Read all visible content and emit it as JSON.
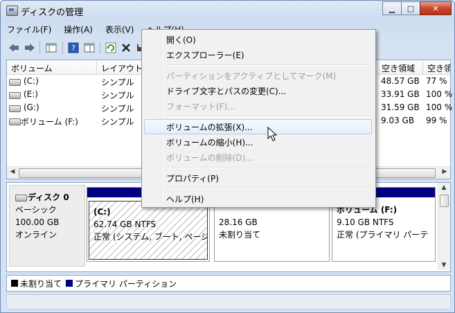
{
  "window": {
    "title": "ディスクの管理"
  },
  "caption_buttons": {
    "minimize": "▁",
    "maximize": "□",
    "close": "✕"
  },
  "menubar": [
    "ファイル(F)",
    "操作(A)",
    "表示(V)",
    "ヘルプ(H)"
  ],
  "volume_list": {
    "columns": [
      "ボリューム",
      "レイアウト",
      "空き領域",
      "空き領"
    ],
    "rows": [
      {
        "volume": "(C:)",
        "layout": "シンプル",
        "free": "48.57 GB",
        "pct": "77 %"
      },
      {
        "volume": "(E:)",
        "layout": "シンプル",
        "free": "33.91 GB",
        "pct": "100 %"
      },
      {
        "volume": "(G:)",
        "layout": "シンプル",
        "free": "31.59 GB",
        "pct": "100 %"
      },
      {
        "volume": "ボリューム (F:)",
        "layout": "シンプル",
        "free": "9.03 GB",
        "pct": "99 %"
      }
    ]
  },
  "disk": {
    "name": "ディスク 0",
    "type": "ベーシック",
    "size": "100.00 GB",
    "status": "オンライン",
    "partitions": [
      {
        "title": "(C:)",
        "size": "62.74 GB NTFS",
        "status": "正常 (システム, ブート, ページ"
      },
      {
        "title": "",
        "size": "28.16 GB",
        "status": "未割り当て"
      },
      {
        "title": "ボリューム (F:)",
        "size": "9.10 GB NTFS",
        "status": "正常 (プライマリ パーテ"
      }
    ]
  },
  "legend": {
    "unallocated": "未割り当て",
    "primary": "プライマリ パーティション",
    "unallocated_color": "#000000",
    "primary_color": "#000080"
  },
  "context_menu": {
    "items": [
      {
        "label": "開く(O)",
        "disabled": false
      },
      {
        "label": "エクスプローラー(E)",
        "disabled": false
      },
      {
        "label": "パーティションをアクティブとしてマーク(M)",
        "disabled": true
      },
      {
        "label": "ドライブ文字とパスの変更(C)...",
        "disabled": false
      },
      {
        "label": "フォーマット(F)...",
        "disabled": true
      },
      {
        "label": "ボリュームの拡張(X)...",
        "disabled": false,
        "highlighted": true
      },
      {
        "label": "ボリュームの縮小(H)...",
        "disabled": false
      },
      {
        "label": "ボリュームの削除(D)...",
        "disabled": true
      },
      {
        "label": "プロパティ(P)",
        "disabled": false
      },
      {
        "label": "ヘルプ(H)",
        "disabled": false
      }
    ]
  }
}
